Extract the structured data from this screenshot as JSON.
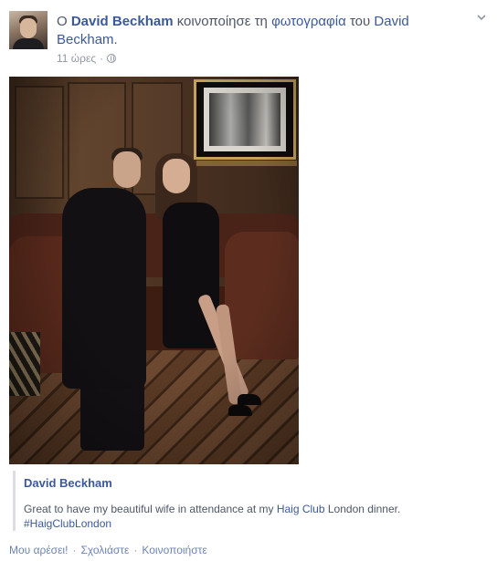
{
  "header": {
    "prefix": "Ο",
    "actor_name": "David Beckham",
    "verb": "κοινοποίησε τη",
    "object_link": "φωτογραφία",
    "preposition": "του",
    "owner_first": "David",
    "owner_last": "Beckham",
    "end_punct": "."
  },
  "meta": {
    "timestamp": "11 ώρες",
    "separator": "·",
    "privacy_icon": "globe-icon"
  },
  "menu": {
    "icon": "chevron-down-icon"
  },
  "photo": {
    "alt": "Photo of a couple seated on a leather sofa"
  },
  "card": {
    "author": "David Beckham",
    "text_before": "Great to have my beautiful wife in attendance at my",
    "text_link": "Haig Club",
    "text_after": "London dinner.",
    "hashtag": "#HaigClubLondon"
  },
  "actions": {
    "like": "Μου αρέσει!",
    "separator": "·",
    "comment": "Σχολιάστε",
    "share": "Κοινοποιήστε"
  },
  "colors": {
    "link": "#3b5998",
    "meta": "#9197a3",
    "text": "#4e5665"
  }
}
